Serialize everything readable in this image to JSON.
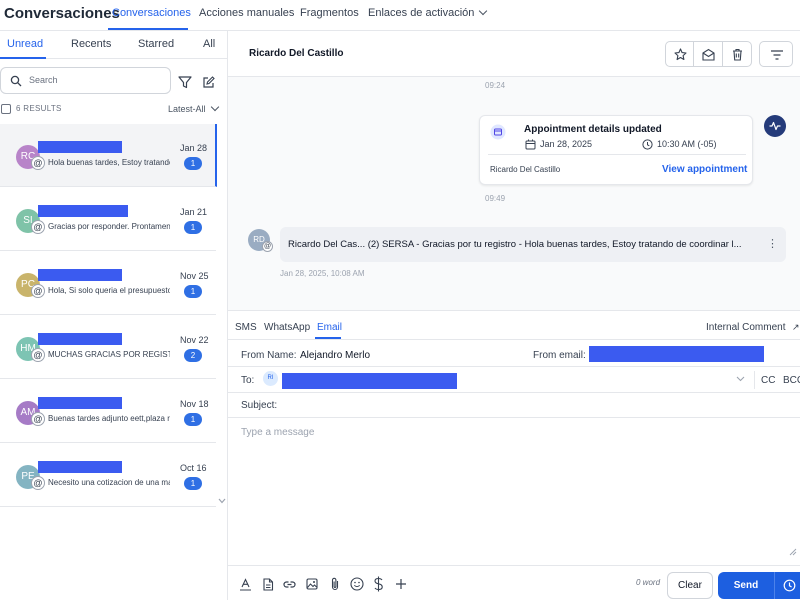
{
  "topnav": {
    "app_title": "Conversaciones",
    "tabs": [
      "Conversaciones",
      "Acciones manuales",
      "Fragmentos",
      "Enlaces de activación"
    ]
  },
  "list": {
    "tabs": [
      "Unread",
      "Recents",
      "Starred",
      "All"
    ],
    "search_placeholder": "Search",
    "results_count": "6 RESULTS",
    "sort_label": "Latest-All",
    "conversations": [
      {
        "initials": "RC",
        "avatar_color": "#b884c9",
        "preview": "Hola buenas tardes, Estoy tratando",
        "date": "Jan 28",
        "unread": "1"
      },
      {
        "initials": "SI",
        "avatar_color": "#7fc3a8",
        "preview": "Gracias por responder. Prontamente",
        "date": "Jan 21",
        "unread": "1"
      },
      {
        "initials": "PC",
        "avatar_color": "#c9b46b",
        "preview": "Hola, Si solo queria el presupuesto..",
        "date": "Nov 25",
        "unread": "1"
      },
      {
        "initials": "HM",
        "avatar_color": "#7dc4b3",
        "preview": "MUCHAS GRACIAS POR REGISTRA",
        "date": "Nov 22",
        "unread": "2"
      },
      {
        "initials": "AM",
        "avatar_color": "#a67bc6",
        "preview": "Buenas tardes adjunto eett,plaza rio",
        "date": "Nov 18",
        "unread": "1"
      },
      {
        "initials": "PE",
        "avatar_color": "#84b4c2",
        "preview": "Necesito una cotizacion de una mar",
        "date": "Oct 16",
        "unread": "1"
      }
    ]
  },
  "chat": {
    "contact_name": "Ricardo Del Castillo",
    "time_1": "09:24",
    "appointment": {
      "title": "Appointment details updated",
      "date": "Jan 28, 2025",
      "time": "10:30 AM (-05)",
      "contact": "Ricardo Del Castillo",
      "link": "View appointment"
    },
    "time_2": "09:49",
    "message": {
      "avatar": "RD",
      "text": "Ricardo Del Cas...  (2)  SERSA - Gracias por tu registro  -  Hola buenas tardes, Estoy tratando de coordinar l...",
      "timestamp": "Jan 28, 2025, 10:08 AM"
    }
  },
  "composer": {
    "channels": [
      "SMS",
      "WhatsApp",
      "Email"
    ],
    "internal_comment": "Internal Comment",
    "from_name_label": "From Name:",
    "from_name_value": "Alejandro Merlo",
    "from_email_label": "From email:",
    "to_label": "To:",
    "to_avatar": "RI",
    "cc_label": "CC",
    "bcc_label": "BCC",
    "subject_label": "Subject:",
    "message_placeholder": "Type a message",
    "word_count": "0 word",
    "clear_label": "Clear",
    "send_label": "Send"
  },
  "colors": {
    "accent": "#2563eb",
    "redaction": "#3b5bf0",
    "send": "#1d5fe0"
  }
}
